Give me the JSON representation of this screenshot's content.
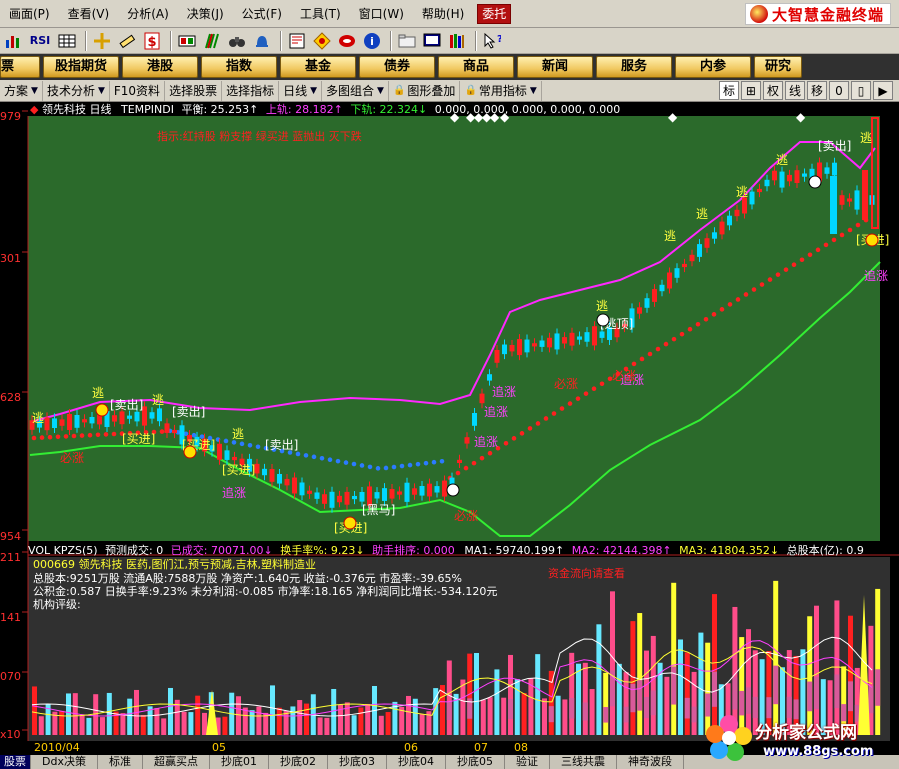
{
  "menubar": {
    "items": [
      "画面(P)",
      "查看(V)",
      "分析(A)",
      "决策(J)",
      "公式(F)",
      "工具(T)",
      "窗口(W)",
      "帮助(H)"
    ],
    "entrust": "委托",
    "brand": "大智慧金融终端"
  },
  "toolbar": {
    "icons": [
      "bars-icon",
      "rsi-icon",
      "grid-icon",
      "crosshair-icon",
      "ruler-icon",
      "dollar-icon",
      "window-icon",
      "stripe-icon",
      "binoculars-icon",
      "bell-icon",
      "news-icon",
      "diamond-icon",
      "ring-icon",
      "info-icon",
      "folder-icon",
      "monitor-icon",
      "books-icon",
      "help-cursor-icon"
    ],
    "rsi_label": "RSI"
  },
  "navbar": {
    "buttons": [
      "票",
      "股指期货",
      "港股",
      "指数",
      "基金",
      "债券",
      "商品",
      "新闻",
      "服务",
      "内参",
      "研究"
    ]
  },
  "funcbar": {
    "items": [
      "方案",
      "技术分析",
      "F10资料",
      "选择股票",
      "选择指标",
      "日线",
      "多图组合",
      "图形叠加",
      "常用指标"
    ],
    "right": [
      "标",
      "⊞",
      "权",
      "线",
      "移",
      "0",
      "▯",
      "▶"
    ]
  },
  "chart_header": {
    "stock": "领先科技 日线",
    "indicator": "TEMPINDI",
    "flat_label": "平衡:",
    "flat_value": "25.253↑",
    "upper_label": "上轨:",
    "upper_value": "28.182↑",
    "lower_label": "下轨:",
    "lower_value": "22.324↓",
    "extra": "0.000, 0.000, 0.000, 0.000, 0.000",
    "tip": "指示:红持股  粉支撑  绿买进  蓝抛出  灭下跌"
  },
  "price_axis": [
    "979",
    "301",
    "628",
    "954"
  ],
  "vol_header": {
    "name": "VOL KPZS(5)",
    "forecast_label": "预测成交:",
    "forecast_value": "0",
    "done_label": "已成交:",
    "done_value": "70071.00↓",
    "turnover_label": "换手率%:",
    "turnover_value": "9.23↓",
    "rank_label": "助手排序:",
    "rank_value": "0.000",
    "ma1": "MA1: 59740.199↑",
    "ma2": "MA2: 42144.398↑",
    "ma3": "MA3: 41804.352↓",
    "capital_label": "总股本(亿):",
    "capital_value": "0.9"
  },
  "info": {
    "line1": "000669 领先科技 医药,图们江,预亏预减,吉林,塑料制造业",
    "line2": "总股本:9251万股 流通A股:7588万股  净资产:1.640元  收益:-0.376元  市盈率:-39.65%",
    "line3": "公积金:0.587  日换手率:9.23%  未分利润:-0.085  市净率:18.165  净利润同比增长:-534.120元",
    "line4": "机构评级:",
    "note": "资金流向请查看"
  },
  "vol_axis": [
    "211",
    "141",
    "070",
    "x10"
  ],
  "dates": [
    "2010/04",
    "05",
    "06",
    "07",
    "08"
  ],
  "bottom_tabs": [
    "股票",
    "Ddx决策",
    "标准",
    "超赢买点",
    "抄底01",
    "抄底02",
    "抄底03",
    "抄底04",
    "抄底05",
    "验证",
    "三线共震",
    "神奇波段"
  ],
  "watermark": {
    "title": "分析家公式网",
    "url": "www.88gs.com"
  },
  "signals": {
    "escape": "逃",
    "sell": "[卖出]",
    "buy": "[买进]",
    "chase": "追涨",
    "must_rise": "必涨",
    "escape_top": "[逃顶]",
    "black_horse": "[黑马]"
  },
  "colors": {
    "chart_bg": "#2b6a2b",
    "upper_band": "#ff28ff",
    "lower_band": "#33ee33",
    "middle_dots_up": "#ff2020",
    "middle_dots_down": "#2b7bff",
    "candle_up": "#ff2020",
    "candle_down": "#00d8ff",
    "accent": "#ffcc00"
  }
}
